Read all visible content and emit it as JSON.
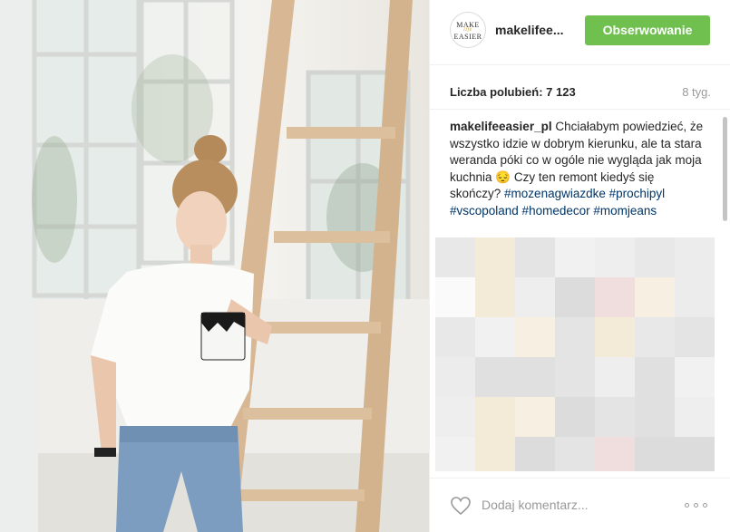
{
  "post": {
    "username": "makelifee...",
    "avatar_logo": {
      "line1": "MAKE",
      "line2": "life",
      "line3": "EASIER"
    },
    "follow_button": "Obserwowanie",
    "likes_text": "Liczba polubień: 7 123",
    "age": "8 tyg.",
    "caption": {
      "author": "makelifeeasier_pl",
      "text": "Chciałabym powiedzieć, że wszystko idzie w dobrym kierunku, ale ta stara weranda póki co w ogóle nie wygląda jak moja kuchnia 😔 Czy ten remont kiedyś się skończy?",
      "hashtags": "#mozenagwiazdke #prochipyl #vscopoland #homedecor #momjeans"
    },
    "comment_placeholder": "Dodaj komentarz...",
    "icons": {
      "like": "heart-icon",
      "more": "more-options-icon"
    },
    "colors": {
      "follow_button": "#70c050",
      "hashtag": "#003569",
      "muted_text": "#999999"
    }
  }
}
